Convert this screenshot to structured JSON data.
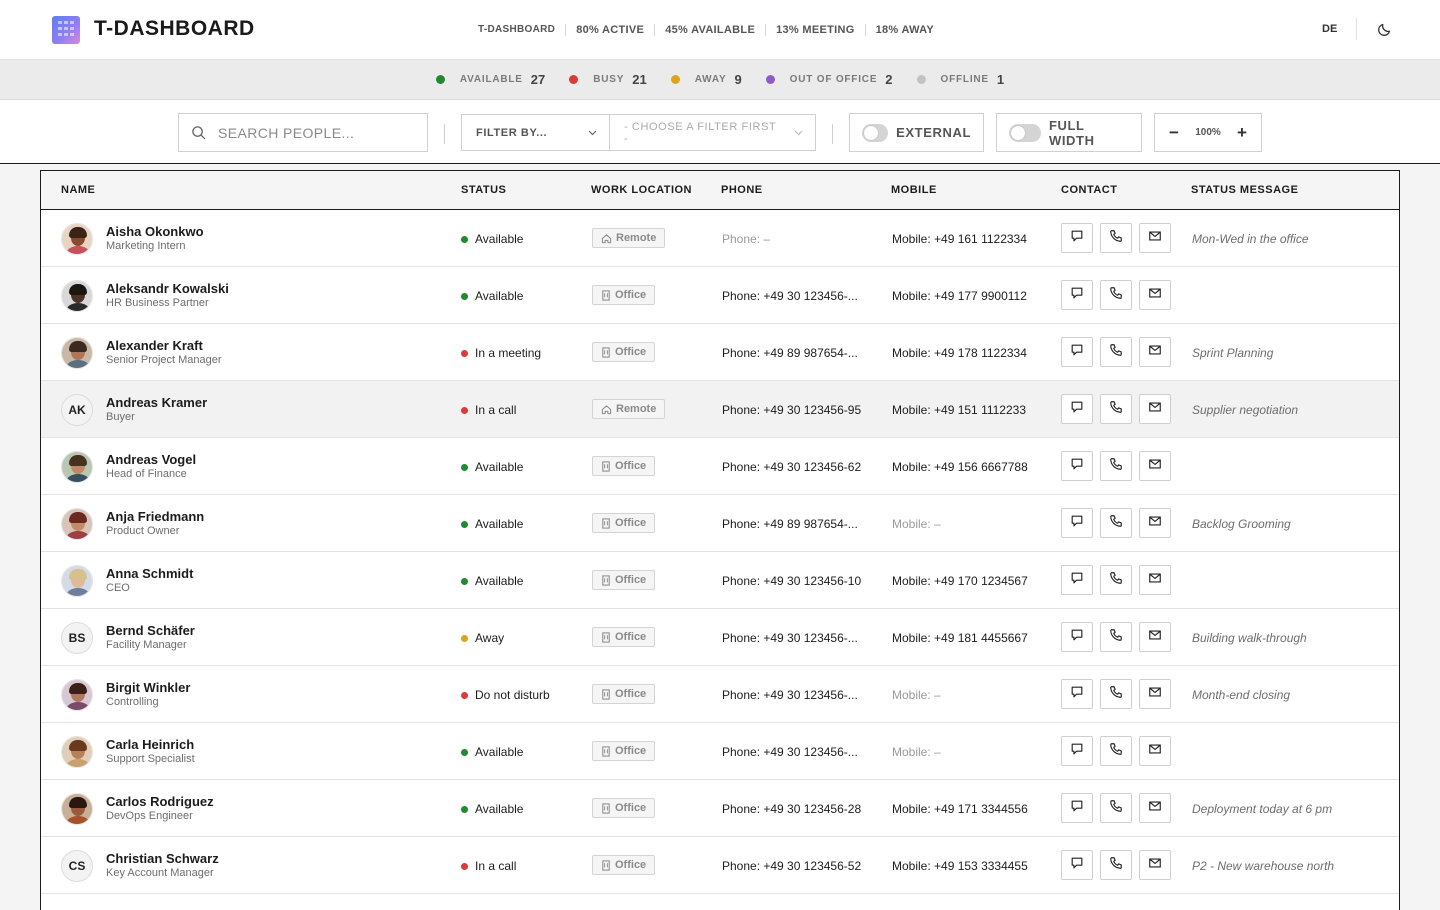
{
  "app": {
    "title": "T-DASHBOARD"
  },
  "header": {
    "stats": [
      "T-DASHBOARD",
      "80% ACTIVE",
      "45% AVAILABLE",
      "13% MEETING",
      "18% AWAY"
    ],
    "language": "DE",
    "theme_icon": "moon-icon"
  },
  "presence": [
    {
      "label": "AVAILABLE",
      "count": "27",
      "color": "#1f8a2e"
    },
    {
      "label": "BUSY",
      "count": "21",
      "color": "#d93a3a"
    },
    {
      "label": "AWAY",
      "count": "9",
      "color": "#e0a21c"
    },
    {
      "label": "OUT OF OFFICE",
      "count": "2",
      "color": "#8e5bc7"
    },
    {
      "label": "OFFLINE",
      "count": "1",
      "color": "#c2c2c2"
    }
  ],
  "toolbar": {
    "search_placeholder": "SEARCH PEOPLE...",
    "filter_by": "FILTER BY...",
    "filter_choose": "- CHOOSE A FILTER FIRST -",
    "external_label": "EXTERNAL",
    "full_width_label": "FULL WIDTH",
    "zoom_value": "100%",
    "zoom_minus": "−",
    "zoom_plus": "+"
  },
  "table": {
    "columns": [
      "NAME",
      "STATUS",
      "WORK LOCATION",
      "PHONE",
      "MOBILE",
      "CONTACT",
      "STATUS MESSAGE"
    ],
    "rows": [
      {
        "name": "Aisha Okonkwo",
        "role": "Marketing Intern",
        "status": "Available",
        "status_color": "#1f8a2e",
        "location": "Remote",
        "phone": "Phone: –",
        "mobile": "Mobile: +49 161 1122334",
        "message": "Mon-Wed in the office"
      },
      {
        "name": "Aleksandr Kowalski",
        "role": "HR Business Partner",
        "status": "Available",
        "status_color": "#1f8a2e",
        "location": "Office",
        "phone": "Phone: +49 30 123456-...",
        "mobile": "Mobile: +49 177 9900112",
        "message": ""
      },
      {
        "name": "Alexander Kraft",
        "role": "Senior Project Manager",
        "status": "In a meeting",
        "status_color": "#d93a3a",
        "location": "Office",
        "phone": "Phone: +49 89 987654-...",
        "mobile": "Mobile: +49 178 1122334",
        "message": "Sprint Planning"
      },
      {
        "name": "Andreas Kramer",
        "role": "Buyer",
        "initials": "AK",
        "status": "In a call",
        "status_color": "#d93a3a",
        "location": "Remote",
        "phone": "Phone: +49 30 123456-95",
        "mobile": "Mobile: +49 151 1112233",
        "message": "Supplier negotiation"
      },
      {
        "name": "Andreas Vogel",
        "role": "Head of Finance",
        "status": "Available",
        "status_color": "#1f8a2e",
        "location": "Office",
        "phone": "Phone: +49 30 123456-62",
        "mobile": "Mobile: +49 156 6667788",
        "message": ""
      },
      {
        "name": "Anja Friedmann",
        "role": "Product Owner",
        "status": "Available",
        "status_color": "#1f8a2e",
        "location": "Office",
        "phone": "Phone: +49 89 987654-...",
        "mobile": "Mobile: –",
        "message": "Backlog Grooming"
      },
      {
        "name": "Anna Schmidt",
        "role": "CEO",
        "status": "Available",
        "status_color": "#1f8a2e",
        "location": "Office",
        "phone": "Phone: +49 30 123456-10",
        "mobile": "Mobile: +49 170 1234567",
        "message": ""
      },
      {
        "name": "Bernd Schäfer",
        "role": "Facility Manager",
        "initials": "BS",
        "status": "Away",
        "status_color": "#e0a21c",
        "location": "Office",
        "phone": "Phone: +49 30 123456-...",
        "mobile": "Mobile: +49 181 4455667",
        "message": "Building walk-through"
      },
      {
        "name": "Birgit Winkler",
        "role": "Controlling",
        "status": "Do not disturb",
        "status_color": "#d93a3a",
        "location": "Office",
        "phone": "Phone: +49 30 123456-...",
        "mobile": "Mobile: –",
        "message": "Month-end closing"
      },
      {
        "name": "Carla Heinrich",
        "role": "Support Specialist",
        "status": "Available",
        "status_color": "#1f8a2e",
        "location": "Office",
        "phone": "Phone: +49 30 123456-...",
        "mobile": "Mobile: –",
        "message": ""
      },
      {
        "name": "Carlos Rodriguez",
        "role": "DevOps Engineer",
        "status": "Available",
        "status_color": "#1f8a2e",
        "location": "Office",
        "phone": "Phone: +49 30 123456-28",
        "mobile": "Mobile: +49 171 3344556",
        "message": "Deployment today at 6 pm"
      },
      {
        "name": "Christian Schwarz",
        "role": "Key Account Manager",
        "initials": "CS",
        "status": "In a call",
        "status_color": "#d93a3a",
        "location": "Office",
        "phone": "Phone: +49 30 123456-52",
        "mobile": "Mobile: +49 153 3334455",
        "message": "P2 - New warehouse north"
      }
    ]
  }
}
